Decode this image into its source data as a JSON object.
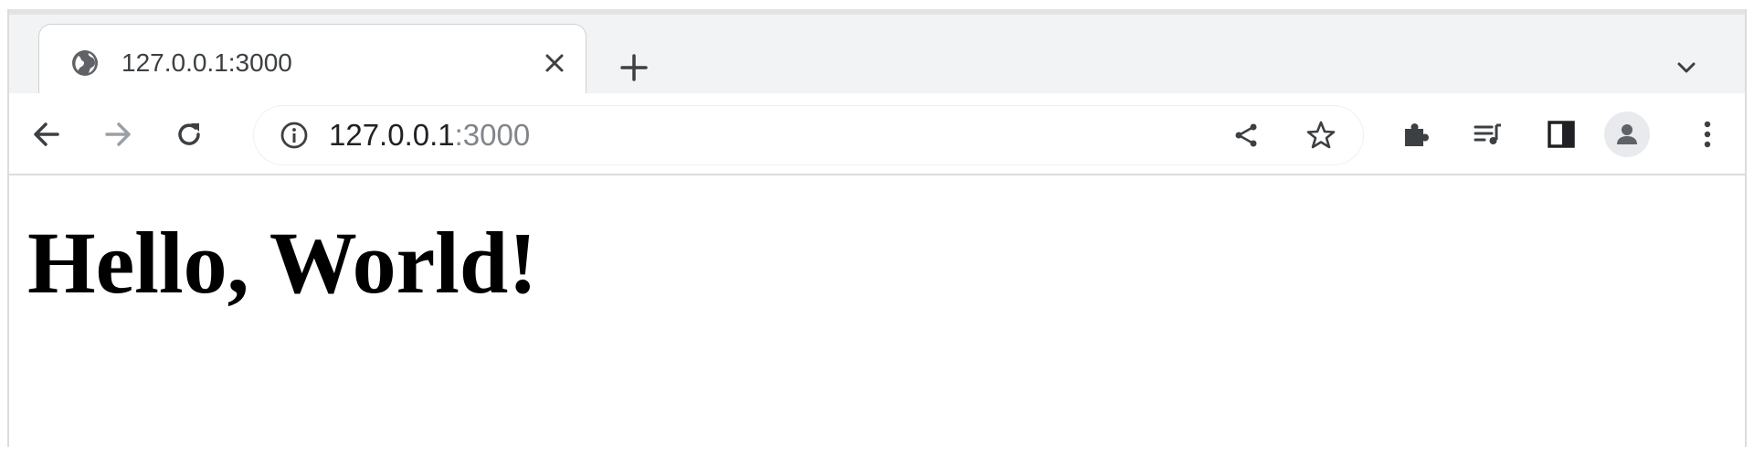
{
  "tab": {
    "title": "127.0.0.1:3000",
    "favicon": "globe-icon"
  },
  "toolbar": {
    "back": "back-arrow-icon",
    "forward": "forward-arrow-icon",
    "reload": "reload-icon",
    "address": {
      "host": "127.0.0.1",
      "port": ":3000"
    }
  },
  "page": {
    "heading": "Hello, World!"
  },
  "colors": {
    "chrome_bg": "#f1f3f4",
    "text": "#202124",
    "muted": "#80868b"
  }
}
